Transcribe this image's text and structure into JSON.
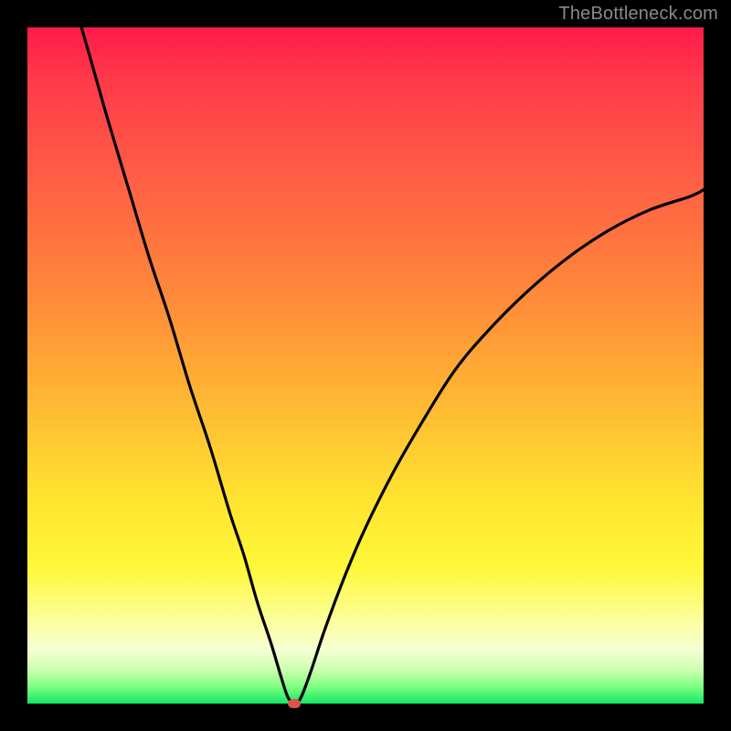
{
  "watermark": "TheBottleneck.com",
  "chart_data": {
    "type": "line",
    "title": "",
    "xlabel": "",
    "ylabel": "",
    "xlim": [
      0,
      100
    ],
    "ylim": [
      0,
      100
    ],
    "grid": false,
    "legend": false,
    "background_gradient": {
      "direction": "top-to-bottom",
      "stops": [
        {
          "pos": 0,
          "color": "#ff1a4a"
        },
        {
          "pos": 40,
          "color": "#ff8a3a"
        },
        {
          "pos": 70,
          "color": "#ffe42f"
        },
        {
          "pos": 92,
          "color": "#f6ffd4"
        },
        {
          "pos": 100,
          "color": "#14e765"
        }
      ]
    },
    "series": [
      {
        "name": "bottleneck-curve",
        "color": "#000000",
        "x": [
          8,
          10,
          12,
          15,
          18,
          21,
          24,
          27,
          30,
          32,
          34,
          36,
          37.5,
          38.5,
          39.5,
          40.5,
          42,
          44,
          47,
          50,
          54,
          58,
          63,
          68,
          74,
          80,
          86,
          92,
          98,
          100
        ],
        "y": [
          100,
          93,
          86,
          76,
          66,
          57,
          47,
          38,
          28,
          22,
          15,
          9,
          4,
          1,
          0,
          1,
          5,
          11,
          19,
          26,
          34,
          41,
          49,
          55,
          61,
          66,
          70,
          73,
          75,
          76
        ]
      }
    ],
    "marker": {
      "x": 39.5,
      "y": 0,
      "color": "#d9534f"
    }
  }
}
